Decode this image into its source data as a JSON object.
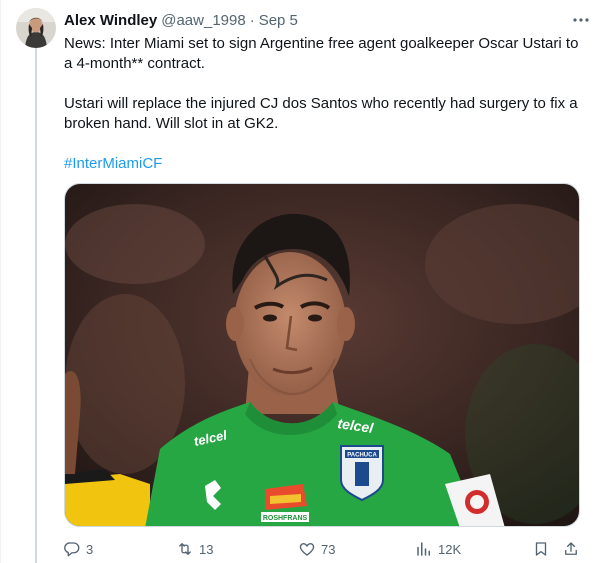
{
  "tweet": {
    "author_name": "Alex Windley",
    "handle": "@aaw_1998",
    "separator": "·",
    "date": "Sep 5",
    "paragraph1": "News: Inter Miami set to sign Argentine free agent goalkeeper Oscar Ustari to a 4-month** contract.",
    "paragraph2": "Ustari will replace the injured CJ dos Santos who recently had surgery to fix a broken hand. Will slot in at GK2.",
    "hashtag": "#InterMiamiCF"
  },
  "photo": {
    "jersey_sponsor": "telcel",
    "shirt_brand": "ROSHFRANS",
    "crest_text": "PACHUCA",
    "sleeve_logo": "telcel"
  },
  "actions": {
    "replies": "3",
    "reposts": "13",
    "likes": "73",
    "views": "12K"
  },
  "colors": {
    "accent": "#1d9bf0",
    "secondary_text": "#536471",
    "primary_text": "#0f1419",
    "jersey_green": "#27a744"
  },
  "icons": [
    "more-icon",
    "reply-icon",
    "repost-icon",
    "like-icon",
    "views-icon",
    "bookmark-icon",
    "share-icon"
  ]
}
